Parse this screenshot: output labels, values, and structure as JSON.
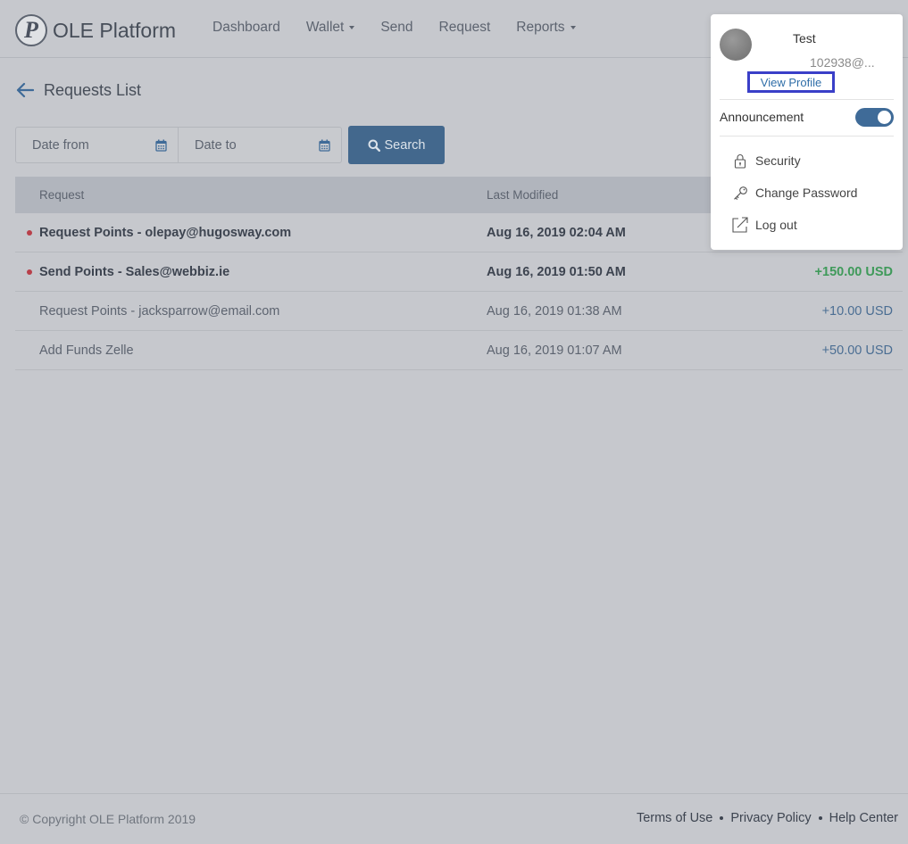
{
  "app": {
    "logo_letter": "P",
    "name": "OLE Platform"
  },
  "nav": {
    "dashboard": "Dashboard",
    "wallet": "Wallet",
    "send": "Send",
    "request": "Request",
    "reports": "Reports"
  },
  "page": {
    "title": "Requests List"
  },
  "filters": {
    "date_from_placeholder": "Date from",
    "date_to_placeholder": "Date to",
    "search_label": "Search"
  },
  "table": {
    "headers": {
      "request": "Request",
      "last_modified": "Last Modified"
    },
    "rows": [
      {
        "request": "Request Points - olepay@hugosway.com",
        "date": "Aug 16, 2019 02:04 AM",
        "amount": "",
        "unread": true
      },
      {
        "request": "Send Points - Sales@webbiz.ie",
        "date": "Aug 16, 2019 01:50 AM",
        "amount": "+150.00 USD",
        "unread": true
      },
      {
        "request": "Request Points - jacksparrow@email.com",
        "date": "Aug 16, 2019 01:38 AM",
        "amount": "+10.00 USD",
        "unread": false
      },
      {
        "request": "Add Funds Zelle",
        "date": "Aug 16, 2019 01:07 AM",
        "amount": "+50.00 USD",
        "unread": false
      }
    ]
  },
  "user_menu": {
    "name": "Test",
    "email": "102938@...",
    "view_profile": "View Profile",
    "announcement": "Announcement",
    "announcement_on": true,
    "security": "Security",
    "change_password": "Change Password",
    "logout": "Log out"
  },
  "footer": {
    "copyright": "© Copyright OLE Platform 2019",
    "terms": "Terms of Use",
    "privacy": "Privacy Policy",
    "help": "Help Center"
  },
  "colors": {
    "accent": "#43688d",
    "positive": "#3f9a5a",
    "unread_dot": "#b8404a",
    "highlight_border": "#3a3fc8"
  }
}
